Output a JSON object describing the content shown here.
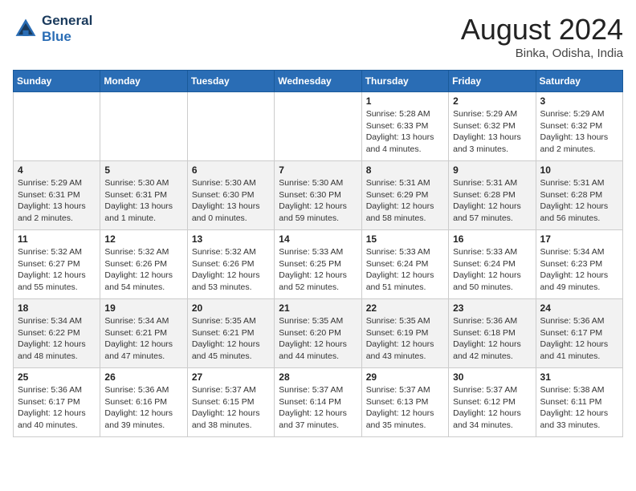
{
  "header": {
    "logo_line1": "General",
    "logo_line2": "Blue",
    "month_year": "August 2024",
    "location": "Binka, Odisha, India"
  },
  "days_of_week": [
    "Sunday",
    "Monday",
    "Tuesday",
    "Wednesday",
    "Thursday",
    "Friday",
    "Saturday"
  ],
  "weeks": [
    [
      {
        "day": "",
        "detail": ""
      },
      {
        "day": "",
        "detail": ""
      },
      {
        "day": "",
        "detail": ""
      },
      {
        "day": "",
        "detail": ""
      },
      {
        "day": "1",
        "detail": "Sunrise: 5:28 AM\nSunset: 6:33 PM\nDaylight: 13 hours\nand 4 minutes."
      },
      {
        "day": "2",
        "detail": "Sunrise: 5:29 AM\nSunset: 6:32 PM\nDaylight: 13 hours\nand 3 minutes."
      },
      {
        "day": "3",
        "detail": "Sunrise: 5:29 AM\nSunset: 6:32 PM\nDaylight: 13 hours\nand 2 minutes."
      }
    ],
    [
      {
        "day": "4",
        "detail": "Sunrise: 5:29 AM\nSunset: 6:31 PM\nDaylight: 13 hours\nand 2 minutes."
      },
      {
        "day": "5",
        "detail": "Sunrise: 5:30 AM\nSunset: 6:31 PM\nDaylight: 13 hours\nand 1 minute."
      },
      {
        "day": "6",
        "detail": "Sunrise: 5:30 AM\nSunset: 6:30 PM\nDaylight: 13 hours\nand 0 minutes."
      },
      {
        "day": "7",
        "detail": "Sunrise: 5:30 AM\nSunset: 6:30 PM\nDaylight: 12 hours\nand 59 minutes."
      },
      {
        "day": "8",
        "detail": "Sunrise: 5:31 AM\nSunset: 6:29 PM\nDaylight: 12 hours\nand 58 minutes."
      },
      {
        "day": "9",
        "detail": "Sunrise: 5:31 AM\nSunset: 6:28 PM\nDaylight: 12 hours\nand 57 minutes."
      },
      {
        "day": "10",
        "detail": "Sunrise: 5:31 AM\nSunset: 6:28 PM\nDaylight: 12 hours\nand 56 minutes."
      }
    ],
    [
      {
        "day": "11",
        "detail": "Sunrise: 5:32 AM\nSunset: 6:27 PM\nDaylight: 12 hours\nand 55 minutes."
      },
      {
        "day": "12",
        "detail": "Sunrise: 5:32 AM\nSunset: 6:26 PM\nDaylight: 12 hours\nand 54 minutes."
      },
      {
        "day": "13",
        "detail": "Sunrise: 5:32 AM\nSunset: 6:26 PM\nDaylight: 12 hours\nand 53 minutes."
      },
      {
        "day": "14",
        "detail": "Sunrise: 5:33 AM\nSunset: 6:25 PM\nDaylight: 12 hours\nand 52 minutes."
      },
      {
        "day": "15",
        "detail": "Sunrise: 5:33 AM\nSunset: 6:24 PM\nDaylight: 12 hours\nand 51 minutes."
      },
      {
        "day": "16",
        "detail": "Sunrise: 5:33 AM\nSunset: 6:24 PM\nDaylight: 12 hours\nand 50 minutes."
      },
      {
        "day": "17",
        "detail": "Sunrise: 5:34 AM\nSunset: 6:23 PM\nDaylight: 12 hours\nand 49 minutes."
      }
    ],
    [
      {
        "day": "18",
        "detail": "Sunrise: 5:34 AM\nSunset: 6:22 PM\nDaylight: 12 hours\nand 48 minutes."
      },
      {
        "day": "19",
        "detail": "Sunrise: 5:34 AM\nSunset: 6:21 PM\nDaylight: 12 hours\nand 47 minutes."
      },
      {
        "day": "20",
        "detail": "Sunrise: 5:35 AM\nSunset: 6:21 PM\nDaylight: 12 hours\nand 45 minutes."
      },
      {
        "day": "21",
        "detail": "Sunrise: 5:35 AM\nSunset: 6:20 PM\nDaylight: 12 hours\nand 44 minutes."
      },
      {
        "day": "22",
        "detail": "Sunrise: 5:35 AM\nSunset: 6:19 PM\nDaylight: 12 hours\nand 43 minutes."
      },
      {
        "day": "23",
        "detail": "Sunrise: 5:36 AM\nSunset: 6:18 PM\nDaylight: 12 hours\nand 42 minutes."
      },
      {
        "day": "24",
        "detail": "Sunrise: 5:36 AM\nSunset: 6:17 PM\nDaylight: 12 hours\nand 41 minutes."
      }
    ],
    [
      {
        "day": "25",
        "detail": "Sunrise: 5:36 AM\nSunset: 6:17 PM\nDaylight: 12 hours\nand 40 minutes."
      },
      {
        "day": "26",
        "detail": "Sunrise: 5:36 AM\nSunset: 6:16 PM\nDaylight: 12 hours\nand 39 minutes."
      },
      {
        "day": "27",
        "detail": "Sunrise: 5:37 AM\nSunset: 6:15 PM\nDaylight: 12 hours\nand 38 minutes."
      },
      {
        "day": "28",
        "detail": "Sunrise: 5:37 AM\nSunset: 6:14 PM\nDaylight: 12 hours\nand 37 minutes."
      },
      {
        "day": "29",
        "detail": "Sunrise: 5:37 AM\nSunset: 6:13 PM\nDaylight: 12 hours\nand 35 minutes."
      },
      {
        "day": "30",
        "detail": "Sunrise: 5:37 AM\nSunset: 6:12 PM\nDaylight: 12 hours\nand 34 minutes."
      },
      {
        "day": "31",
        "detail": "Sunrise: 5:38 AM\nSunset: 6:11 PM\nDaylight: 12 hours\nand 33 minutes."
      }
    ]
  ]
}
